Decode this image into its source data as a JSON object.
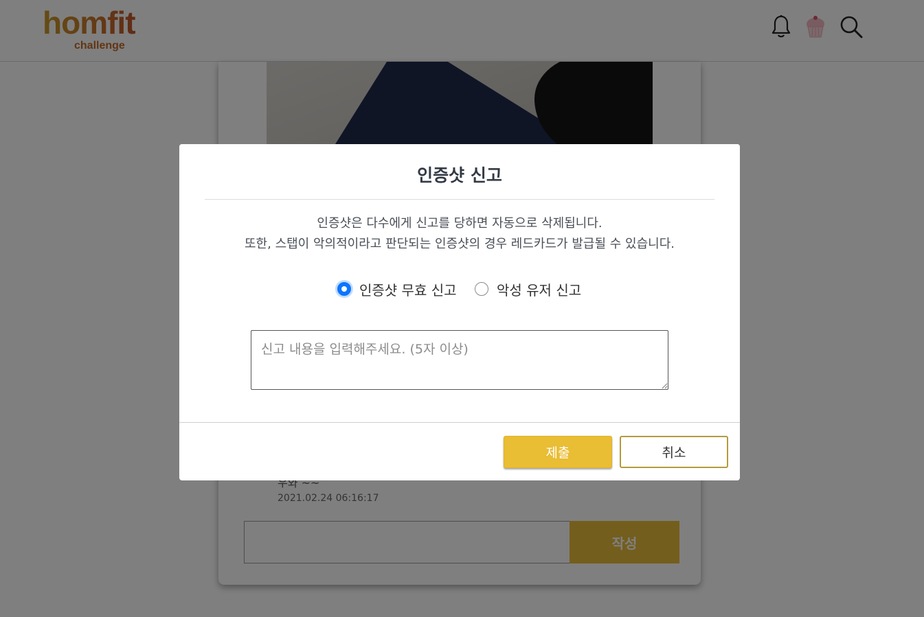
{
  "header": {
    "logo_main": "homfit",
    "logo_sub": "challenge",
    "icons": [
      "bell-icon",
      "cupcake-avatar-icon",
      "search-icon"
    ]
  },
  "feed": {
    "comment_text": "우와 ~~",
    "comment_date": "2021.02.24 06:16:17",
    "comment_submit_label": "작성"
  },
  "modal": {
    "title": "인증샷 신고",
    "desc_line1": "인증샷은 다수에게 신고를 당하면 자동으로 삭제됩니다.",
    "desc_line2": "또한, 스탭이 악의적이라고 판단되는 인증샷의 경우 레드카드가 발급될 수 있습니다.",
    "options": [
      {
        "label": "인증샷 무효 신고",
        "checked": true
      },
      {
        "label": "악성 유저 신고",
        "checked": false
      }
    ],
    "reason_placeholder": "신고 내용을 입력해주세요. (5자 이상)",
    "reason_value": "",
    "submit_label": "제출",
    "cancel_label": "취소"
  },
  "colors": {
    "accent": "#e9bd34",
    "radio_checked": "#0d75ff",
    "overlay": "rgba(0,0,0,0.5)"
  }
}
